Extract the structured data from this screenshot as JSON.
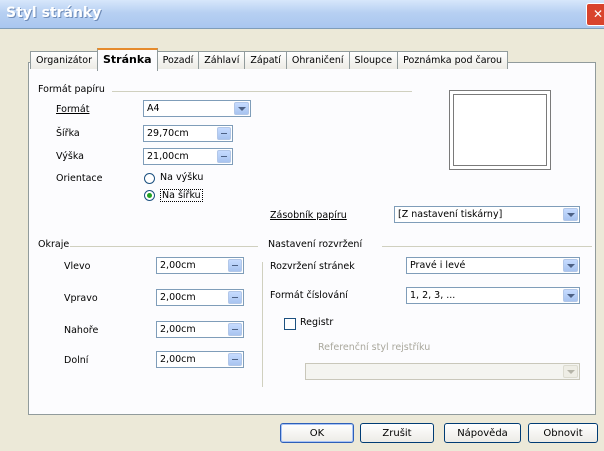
{
  "window": {
    "title": "Styl stránky",
    "close_glyph": "✕"
  },
  "tabs": [
    {
      "label": "Organizátor"
    },
    {
      "label": "Stránka",
      "active": true
    },
    {
      "label": "Pozadí"
    },
    {
      "label": "Záhlaví"
    },
    {
      "label": "Zápatí"
    },
    {
      "label": "Ohraničení"
    },
    {
      "label": "Sloupce"
    },
    {
      "label": "Poznámka pod čarou"
    }
  ],
  "paper": {
    "group_title": "Formát papíru",
    "format_label": "Formát",
    "format_value": "A4",
    "width_label": "Šířka",
    "width_value": "29,70cm",
    "height_label": "Výška",
    "height_value": "21,00cm",
    "orientation_label": "Orientace",
    "portrait_label": "Na výšku",
    "landscape_label": "Na šířku",
    "tray_label": "Zásobník papíru",
    "tray_value": "[Z nastavení tiskárny]"
  },
  "margins": {
    "group_title": "Okraje",
    "left_label": "Vlevo",
    "left_value": "2,00cm",
    "right_label": "Vpravo",
    "right_value": "2,00cm",
    "top_label": "Nahoře",
    "top_value": "2,00cm",
    "bottom_label": "Dolní",
    "bottom_value": "2,00cm"
  },
  "layout": {
    "group_title": "Nastavení rozvržení",
    "page_layout_label": "Rozvržení stránek",
    "page_layout_value": "Pravé i levé",
    "numbering_label": "Formát číslování",
    "numbering_value": "1, 2, 3, ...",
    "register_label": "Registr",
    "ref_style_label": "Referenční styl rejstříku",
    "ref_style_value": ""
  },
  "buttons": {
    "ok": "OK",
    "cancel": "Zrušit",
    "help": "Nápověda",
    "reset": "Obnovit"
  }
}
